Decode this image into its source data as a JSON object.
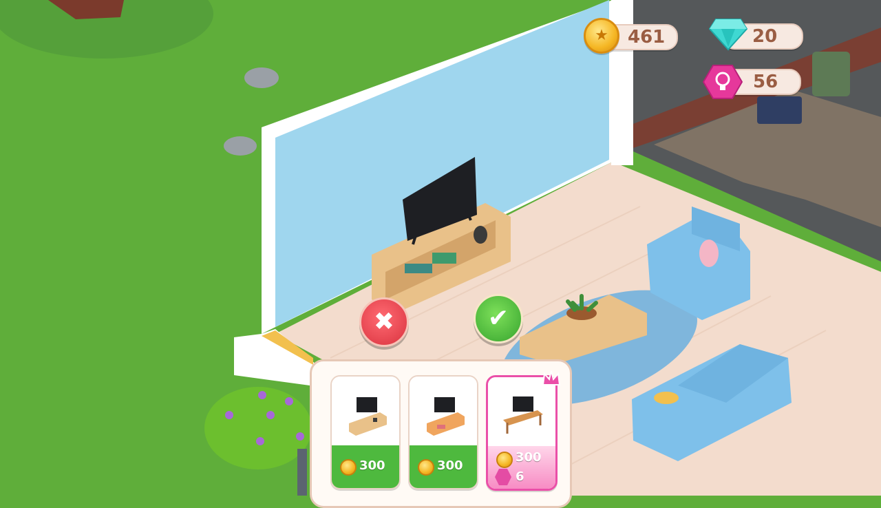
{
  "currencies": {
    "coins": "461",
    "diamonds": "20",
    "stars": "56"
  },
  "colors": {
    "grass": "#5fae3a",
    "wall": "#9fd6ee",
    "floor": "#f3dccd",
    "confirm": "#46b43d",
    "cancel": "#e0404a",
    "premium": "#e44ca4"
  },
  "placement": {
    "cancel_icon": "x-icon",
    "confirm_icon": "check-icon"
  },
  "shop": {
    "items": [
      {
        "name": "tv-stand-natural",
        "coin_price": "300"
      },
      {
        "name": "tv-stand-orange",
        "coin_price": "300"
      },
      {
        "name": "tv-stand-premium",
        "coin_price": "300",
        "gem_price": "6"
      }
    ]
  }
}
